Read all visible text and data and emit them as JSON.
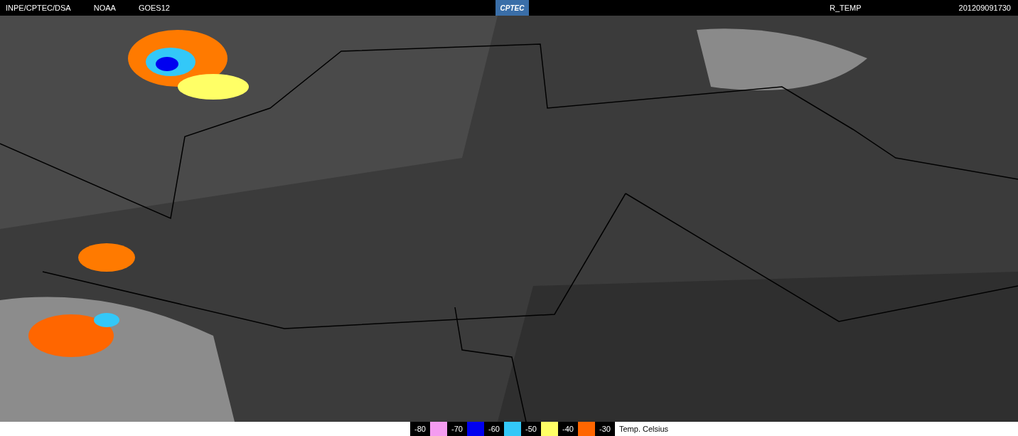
{
  "header": {
    "left": [
      "INPE/CPTEC/DSA",
      "NOAA",
      "GOES12"
    ],
    "logo": "CPTEC",
    "product": "R_TEMP",
    "timestamp": "201209091730"
  },
  "legend": {
    "steps": [
      {
        "label": "-80",
        "color": "#f49cf0"
      },
      {
        "label": "-70",
        "color": "#0000f0"
      },
      {
        "label": "-60",
        "color": "#33c8f8"
      },
      {
        "label": "-50",
        "color": "#ffff66"
      },
      {
        "label": "-40",
        "color": "#ff6600"
      },
      {
        "label": "-30"
      }
    ],
    "unit": "Temp. Celsius"
  }
}
